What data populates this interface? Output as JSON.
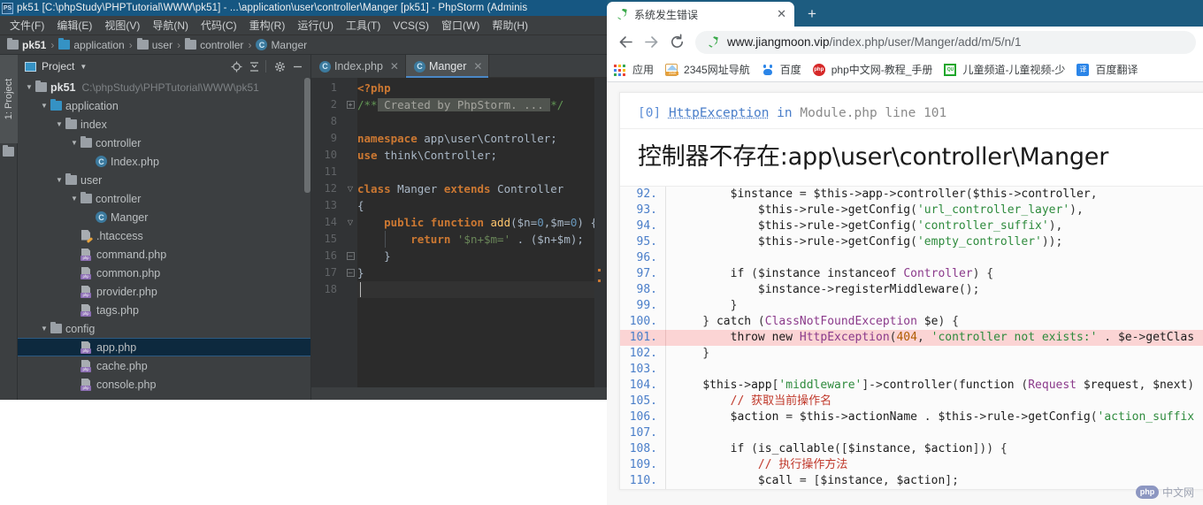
{
  "ide": {
    "window_title": "pk51 [C:\\phpStudy\\PHPTutorial\\WWW\\pk51] - ...\\application\\user\\controller\\Manger [pk51] - PhpStorm (Adminis",
    "app_logo_text": "PS",
    "menus": [
      "文件(F)",
      "编辑(E)",
      "视图(V)",
      "导航(N)",
      "代码(C)",
      "重构(R)",
      "运行(U)",
      "工具(T)",
      "VCS(S)",
      "窗口(W)",
      "帮助(H)"
    ],
    "breadcrumb": [
      {
        "label": "pk51",
        "icon": "folder-icon",
        "bold": true
      },
      {
        "label": "application",
        "icon": "folder-icon",
        "bold": false
      },
      {
        "label": "user",
        "icon": "folder-icon",
        "bold": false
      },
      {
        "label": "controller",
        "icon": "folder-icon",
        "bold": false
      },
      {
        "label": "Manger",
        "icon": "php-class-icon",
        "bold": false
      }
    ],
    "left_strip": {
      "tab_label": "1: Project"
    },
    "project_panel": {
      "title": "Project",
      "header_buttons": [
        "locate-target-icon",
        "collapse-all-icon",
        "gear-icon",
        "minimize-icon"
      ],
      "tree": [
        {
          "label": "pk51",
          "path": "C:\\phpStudy\\PHPTutorial\\WWW\\pk51",
          "indent": 0,
          "arrow": "▼",
          "icon": "folder-gray-icon",
          "bold": true,
          "selected": false
        },
        {
          "label": "application",
          "path": "",
          "indent": 1,
          "arrow": "▼",
          "icon": "folder-blue-icon",
          "bold": false,
          "selected": false
        },
        {
          "label": "index",
          "path": "",
          "indent": 2,
          "arrow": "▼",
          "icon": "folder-gray-icon",
          "bold": false,
          "selected": false
        },
        {
          "label": "controller",
          "path": "",
          "indent": 3,
          "arrow": "▼",
          "icon": "folder-gray-icon",
          "bold": false,
          "selected": false
        },
        {
          "label": "Index.php",
          "path": "",
          "indent": 4,
          "arrow": "",
          "icon": "php-class-icon",
          "bold": false,
          "selected": false
        },
        {
          "label": "user",
          "path": "",
          "indent": 2,
          "arrow": "▼",
          "icon": "folder-gray-icon",
          "bold": false,
          "selected": false
        },
        {
          "label": "controller",
          "path": "",
          "indent": 3,
          "arrow": "▼",
          "icon": "folder-gray-icon",
          "bold": false,
          "selected": false
        },
        {
          "label": "Manger",
          "path": "",
          "indent": 4,
          "arrow": "",
          "icon": "php-class-icon",
          "bold": false,
          "selected": false
        },
        {
          "label": ".htaccess",
          "path": "",
          "indent": 3,
          "arrow": "",
          "icon": "htaccess-icon",
          "bold": false,
          "selected": false
        },
        {
          "label": "command.php",
          "path": "",
          "indent": 3,
          "arrow": "",
          "icon": "php-file-icon",
          "bold": false,
          "selected": false
        },
        {
          "label": "common.php",
          "path": "",
          "indent": 3,
          "arrow": "",
          "icon": "php-file-icon",
          "bold": false,
          "selected": false
        },
        {
          "label": "provider.php",
          "path": "",
          "indent": 3,
          "arrow": "",
          "icon": "php-file-icon",
          "bold": false,
          "selected": false
        },
        {
          "label": "tags.php",
          "path": "",
          "indent": 3,
          "arrow": "",
          "icon": "php-file-icon",
          "bold": false,
          "selected": false
        },
        {
          "label": "config",
          "path": "",
          "indent": 1,
          "arrow": "▼",
          "icon": "folder-gray-icon",
          "bold": false,
          "selected": false
        },
        {
          "label": "app.php",
          "path": "",
          "indent": 3,
          "arrow": "",
          "icon": "php-file-icon",
          "bold": false,
          "selected": true
        },
        {
          "label": "cache.php",
          "path": "",
          "indent": 3,
          "arrow": "",
          "icon": "php-file-icon",
          "bold": false,
          "selected": false
        },
        {
          "label": "console.php",
          "path": "",
          "indent": 3,
          "arrow": "",
          "icon": "php-file-icon",
          "bold": false,
          "selected": false
        }
      ]
    },
    "editor": {
      "tabs": [
        {
          "label": "Index.php",
          "active": false,
          "close": "✕"
        },
        {
          "label": "Manger",
          "active": true,
          "close": "✕"
        }
      ],
      "line_numbers": [
        "1",
        "2",
        "8",
        "9",
        "10",
        "11",
        "12",
        "13",
        "14",
        "15",
        "16",
        "17",
        "18"
      ],
      "lines": [
        "<?php",
        "/** Created by PhpStorm. ... */",
        "",
        "namespace app\\user\\Controller;",
        "use think\\Controller;",
        "",
        "class Manger extends Controller",
        "{",
        "    public function add($n=0,$m=0) {",
        "        return '$n+$m=' . ($n+$m);",
        "    }",
        "}",
        ""
      ],
      "fold_markers": [
        "",
        "+",
        "",
        "",
        "",
        "",
        "▽",
        "",
        "▽",
        "",
        "⊟",
        "⊟",
        ""
      ]
    }
  },
  "browser": {
    "tab": {
      "title": "系统发生错误",
      "favicon": "leaf-icon",
      "close_label": "✕"
    },
    "new_tab_label": "+",
    "nav": {
      "back": "←",
      "forward": "→",
      "reload": "⟳"
    },
    "omnibox": {
      "site_icon": "leaf-icon",
      "host": "www.jiangmoon.vip",
      "path": "/index.php/user/Manger/add/m/5/n/1"
    },
    "bookmarks": [
      {
        "label": "应用",
        "icon": "apps-grid-icon"
      },
      {
        "label": "2345网址导航",
        "icon": "2345-icon"
      },
      {
        "label": "百度",
        "icon": "baidu-icon"
      },
      {
        "label": "php中文网-教程_手册",
        "icon": "php-cn-icon"
      },
      {
        "label": "儿童频道-儿童视频-少",
        "icon": "kids-channel-icon"
      },
      {
        "label": "百度翻译",
        "icon": "baidu-fanyi-icon"
      }
    ]
  },
  "error_page": {
    "header": {
      "index": "[0]",
      "exception": "HttpException",
      "in_word": "in",
      "file": "Module.php",
      "line_word": "line",
      "line_number": "101"
    },
    "message": "控制器不存在:app\\user\\controller\\Manger",
    "highlight_line": 101,
    "code_lines": [
      {
        "n": "92.",
        "text": "        $instance = $this->app->controller($this->controller,"
      },
      {
        "n": "93.",
        "text": "            $this->rule->getConfig('url_controller_layer'),"
      },
      {
        "n": "94.",
        "text": "            $this->rule->getConfig('controller_suffix'),"
      },
      {
        "n": "95.",
        "text": "            $this->rule->getConfig('empty_controller'));"
      },
      {
        "n": "96.",
        "text": ""
      },
      {
        "n": "97.",
        "text": "        if ($instance instanceof Controller) {"
      },
      {
        "n": "98.",
        "text": "            $instance->registerMiddleware();"
      },
      {
        "n": "99.",
        "text": "        }"
      },
      {
        "n": "100.",
        "text": "    } catch (ClassNotFoundException $e) {"
      },
      {
        "n": "101.",
        "text": "        throw new HttpException(404, 'controller not exists:' . $e->getClas"
      },
      {
        "n": "102.",
        "text": "    }"
      },
      {
        "n": "103.",
        "text": ""
      },
      {
        "n": "104.",
        "text": "    $this->app['middleware']->controller(function (Request $request, $next)"
      },
      {
        "n": "105.",
        "text": "        // 获取当前操作名"
      },
      {
        "n": "106.",
        "text": "        $action = $this->actionName . $this->rule->getConfig('action_suffix"
      },
      {
        "n": "107.",
        "text": ""
      },
      {
        "n": "108.",
        "text": "        if (is_callable([$instance, $action])) {"
      },
      {
        "n": "109.",
        "text": "            // 执行操作方法"
      },
      {
        "n": "110.",
        "text": "            $call = [$instance, $action];"
      }
    ],
    "watermark": {
      "badge": "php",
      "text": "中文网"
    }
  },
  "colors": {
    "ide_titlebar": "#165782",
    "ide_chrome": "#3c3f41",
    "editor_bg": "#2b2b2b",
    "tree_selection": "#0d293e",
    "tab_underline": "#4a88c7",
    "browser_tabstrip": "#1d5c80",
    "error_highlight": "#fbd4d4",
    "link_blue": "#4a7ec9"
  }
}
